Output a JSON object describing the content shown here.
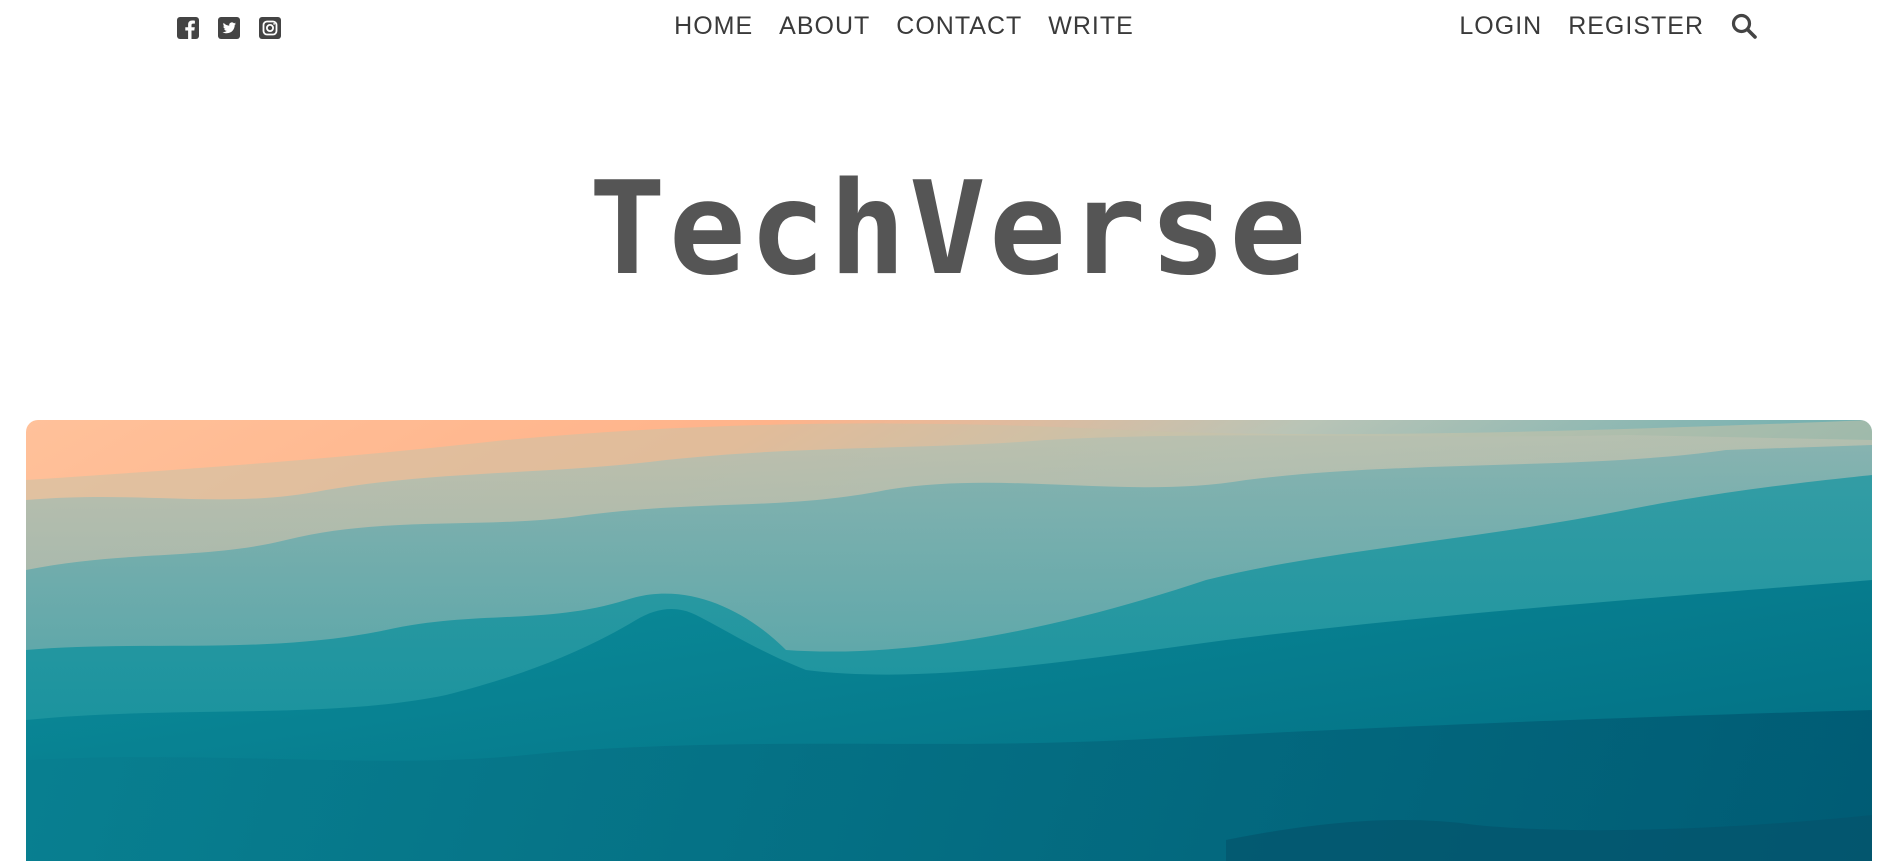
{
  "social": {
    "items": [
      {
        "icon": "facebook-icon"
      },
      {
        "icon": "twitter-icon"
      },
      {
        "icon": "instagram-icon"
      }
    ]
  },
  "nav": {
    "links": [
      "HOME",
      "ABOUT",
      "CONTACT",
      "WRITE"
    ]
  },
  "auth": {
    "login_label": "LOGIN",
    "register_label": "REGISTER",
    "search_icon": "search-icon"
  },
  "brand": {
    "title": "TechVerse"
  },
  "hero": {
    "sky_color": "#ffb38a",
    "teal_color": "#0a8d9a",
    "deep_color": "#006a80"
  },
  "colors": {
    "text": "#3a3a3a",
    "brand_text": "#555555",
    "icon": "#444444"
  }
}
